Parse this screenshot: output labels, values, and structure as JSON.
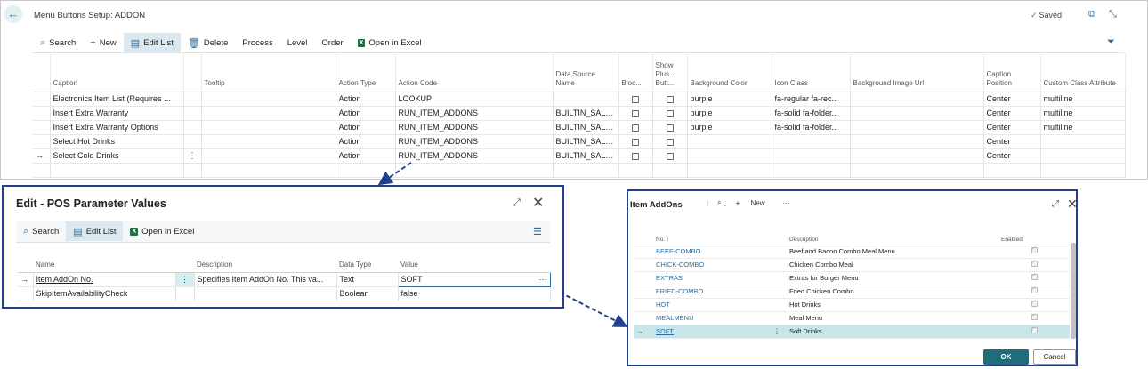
{
  "main": {
    "title": "Menu Buttons Setup: ADDON",
    "saved_label": "Saved",
    "toolbar": {
      "search": "Search",
      "new": "New",
      "edit_list": "Edit List",
      "delete": "Delete",
      "process": "Process",
      "level": "Level",
      "order": "Order",
      "open_excel": "Open in Excel"
    },
    "columns": [
      "Caption",
      "Tooltip",
      "Action Type",
      "Action Code",
      "Data Source Name",
      "Bloc...",
      "Show Plus... Butt...",
      "Background Color",
      "Icon Class",
      "Background Image Url",
      "Caption Position",
      "Custom Class Attribute"
    ],
    "rows": [
      {
        "caption": "Electronics  Item List (Requires ...",
        "tooltip": "",
        "action_type": "Action",
        "action_code": "LOOKUP",
        "data_source": "",
        "bg_color": "purple",
        "icon_class": "fa-regular fa-rec...",
        "bg_image": "",
        "caption_pos": "Center",
        "custom_class": "multiline"
      },
      {
        "caption": "Insert Extra Warranty",
        "tooltip": "",
        "action_type": "Action",
        "action_code": "RUN_ITEM_ADDONS",
        "data_source": "BUILTIN_SALE...",
        "bg_color": "purple",
        "icon_class": "fa-solid fa-folder...",
        "bg_image": "",
        "caption_pos": "Center",
        "custom_class": "multiline"
      },
      {
        "caption": "Insert Extra Warranty Options",
        "tooltip": "",
        "action_type": "Action",
        "action_code": "RUN_ITEM_ADDONS",
        "data_source": "BUILTIN_SALE...",
        "bg_color": "purple",
        "icon_class": "fa-solid fa-folder...",
        "bg_image": "",
        "caption_pos": "Center",
        "custom_class": "multiline"
      },
      {
        "caption": "Select Hot Drinks",
        "tooltip": "",
        "action_type": "Action",
        "action_code": "RUN_ITEM_ADDONS",
        "data_source": "BUILTIN_SALE...",
        "bg_color": "",
        "icon_class": "",
        "bg_image": "",
        "caption_pos": "Center",
        "custom_class": ""
      },
      {
        "caption": "Select Cold Drinks",
        "tooltip": "",
        "action_type": "Action",
        "action_code": "RUN_ITEM_ADDONS",
        "data_source": "BUILTIN_SALE...",
        "bg_color": "",
        "icon_class": "",
        "bg_image": "",
        "caption_pos": "Center",
        "custom_class": ""
      }
    ]
  },
  "pos_dialog": {
    "title": "Edit - POS Parameter Values",
    "toolbar": {
      "search": "Search",
      "edit_list": "Edit List",
      "open_excel": "Open in Excel"
    },
    "columns": [
      "Name",
      "Description",
      "Data Type",
      "Value"
    ],
    "rows": [
      {
        "name": "Item AddOn No.",
        "description": "Specifies Item AddOn No. This va...",
        "data_type": "Text",
        "value": "SOFT"
      },
      {
        "name": "SkipItemAvailabilityCheck",
        "description": "",
        "data_type": "Boolean",
        "value": "false"
      }
    ]
  },
  "addons_dialog": {
    "title": "Item AddOns",
    "new_label": "New",
    "columns": [
      "No. ↑",
      "Description",
      "Enabled"
    ],
    "rows": [
      {
        "no": "BEEF-COMBO",
        "description": "Beef and Bacon Combo Meal Menu"
      },
      {
        "no": "CHICK-COMBO",
        "description": "Chicken Combo Meal"
      },
      {
        "no": "EXTRAS",
        "description": "Extras for Burger Menu"
      },
      {
        "no": "FRIED-COMBO",
        "description": "Fried Chicken Combo"
      },
      {
        "no": "HOT",
        "description": "Hot Drinks"
      },
      {
        "no": "MEALMENU",
        "description": "Meal Menu"
      },
      {
        "no": "SOFT",
        "description": "Soft Drinks"
      }
    ],
    "ok_label": "OK",
    "cancel_label": "Cancel"
  },
  "colors": {
    "accent": "#2e6e9e",
    "frame": "#23408e",
    "selected_row": "#c6e6ea",
    "ok_button": "#1f6d7a"
  }
}
